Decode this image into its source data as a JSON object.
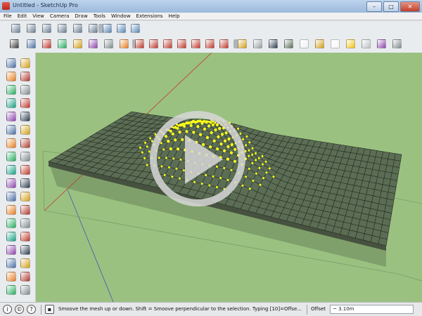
{
  "window": {
    "title": "Untitled - SketchUp Pro",
    "controls": {
      "minimize": "–",
      "maximize": "□",
      "close": "✕"
    }
  },
  "menu": [
    "File",
    "Edit",
    "View",
    "Camera",
    "Draw",
    "Tools",
    "Window",
    "Extensions",
    "Help"
  ],
  "status": {
    "message": "Smoove the mesh up or down.  Shift = Smoove perpendicular to the selection.  Typing [10]=Offse...",
    "offset_label": "Offset",
    "offset_value": "~ 3.10m",
    "icons": [
      "geo-location-icon",
      "credits-icon",
      "help-icon"
    ]
  },
  "colors": {
    "ground": "#9bc181",
    "mesh_fill": "#5b6d54",
    "mesh_line": "#1b1f1a",
    "selection": "#ffff1a",
    "axis_red": "#c0392b",
    "axis_blue": "#3c59b5",
    "play_overlay": "#d7d7d7"
  },
  "overlay": {
    "icon": "play-button-icon"
  }
}
